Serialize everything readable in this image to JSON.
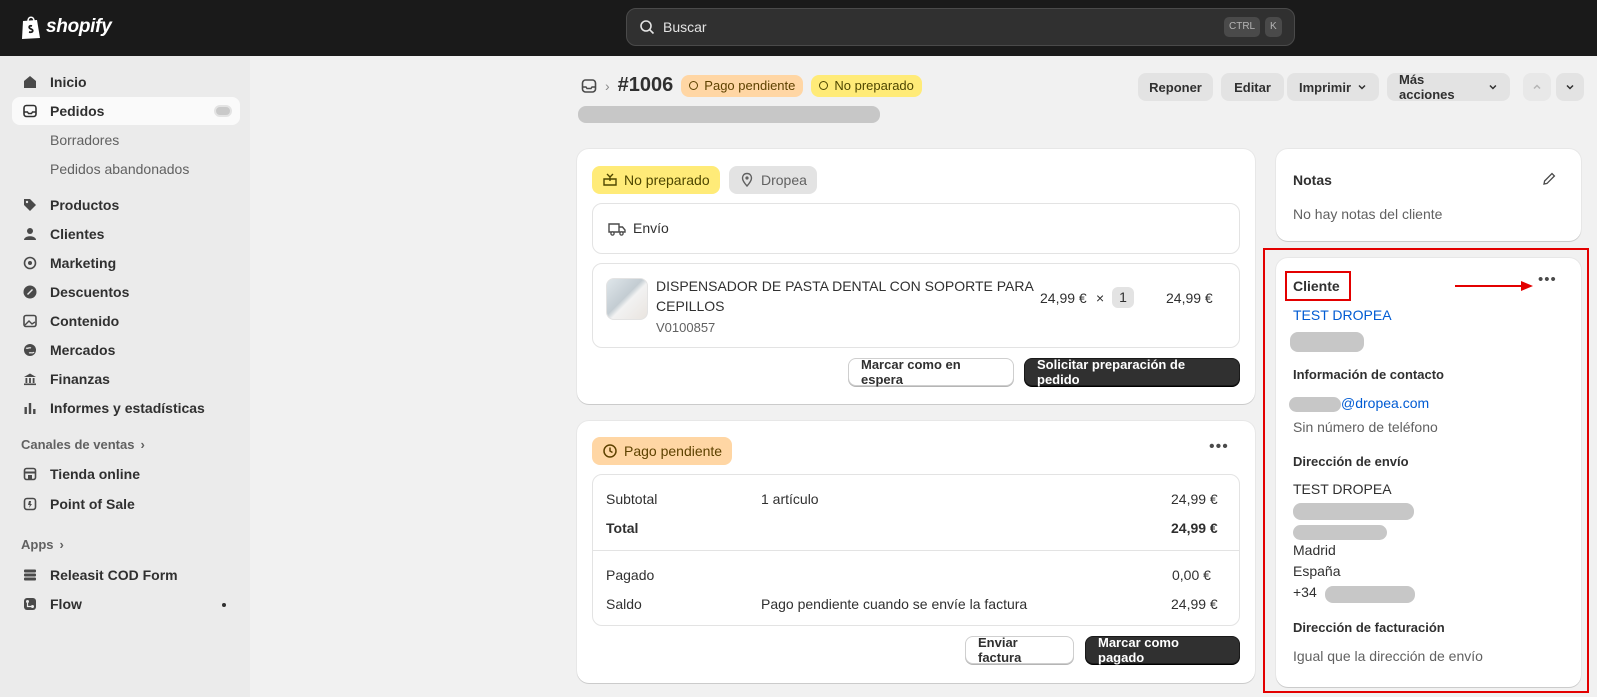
{
  "brand": {
    "logo_text": "shopify"
  },
  "search": {
    "placeholder": "Buscar",
    "shortcut_1": "CTRL",
    "shortcut_2": "K"
  },
  "sidebar": {
    "items": [
      {
        "label": "Inicio",
        "icon": "home-icon"
      },
      {
        "label": "Pedidos",
        "icon": "inbox-icon"
      },
      {
        "label": "Productos",
        "icon": "tag-icon"
      },
      {
        "label": "Clientes",
        "icon": "person-icon"
      },
      {
        "label": "Marketing",
        "icon": "target-icon"
      },
      {
        "label": "Descuentos",
        "icon": "discount-icon"
      },
      {
        "label": "Contenido",
        "icon": "image-icon"
      },
      {
        "label": "Mercados",
        "icon": "globe-icon"
      },
      {
        "label": "Finanzas",
        "icon": "bank-icon"
      },
      {
        "label": "Informes y estadísticas",
        "icon": "chart-icon"
      }
    ],
    "sub_items": [
      "Borradores",
      "Pedidos abandonados"
    ],
    "sales_channels_label": "Canales de ventas",
    "channels": [
      {
        "label": "Tienda online",
        "icon": "store-icon"
      },
      {
        "label": "Point of Sale",
        "icon": "pos-icon"
      }
    ],
    "apps_label": "Apps",
    "apps": [
      {
        "label": "Releasit COD Form",
        "icon": "stack-icon"
      },
      {
        "label": "Flow",
        "icon": "flow-icon"
      }
    ]
  },
  "order": {
    "id": "#1006",
    "badge_payment": "Pago pendiente",
    "badge_fulfillment": "No preparado",
    "actions": {
      "restock": "Reponer",
      "edit": "Editar",
      "print": "Imprimir",
      "more": "Más acciones"
    }
  },
  "fulfillment": {
    "status": "No preparado",
    "location": "Dropea",
    "shipping_label": "Envío",
    "product_title_line1": "DISPENSADOR DE PASTA DENTAL CON SOPORTE PARA",
    "product_title_line2": "CEPILLOS",
    "sku": "V0100857",
    "unit_price": "24,99 €",
    "times": "×",
    "quantity": "1",
    "line_total": "24,99 €",
    "hold_button": "Marcar como en espera",
    "request_button": "Solicitar preparación de pedido"
  },
  "payment": {
    "status": "Pago pendiente",
    "subtotal_label": "Subtotal",
    "subtotal_items": "1 artículo",
    "subtotal_value": "24,99 €",
    "total_label": "Total",
    "total_value": "24,99 €",
    "paid_label": "Pagado",
    "paid_value": "0,00 €",
    "balance_label": "Saldo",
    "balance_note": "Pago pendiente cuando se envíe la factura",
    "balance_value": "24,99 €",
    "invoice_button": "Enviar factura",
    "mark_paid_button": "Marcar como pagado"
  },
  "notes": {
    "title": "Notas",
    "empty": "No hay notas del cliente"
  },
  "customer": {
    "title": "Cliente",
    "name": "TEST DROPEA",
    "contact_heading": "Información de contacto",
    "email_domain": "@dropea.com",
    "phone_empty": "Sin número de teléfono",
    "shipping_heading": "Dirección de envío",
    "ship_name": "TEST DROPEA",
    "city": "Madrid",
    "country": "España",
    "phone_prefix": "+34",
    "billing_heading": "Dirección de facturación",
    "billing_same": "Igual que la dirección de envío"
  },
  "colors": {
    "annotation_red": "#e30000",
    "link_blue": "#005bd3"
  }
}
